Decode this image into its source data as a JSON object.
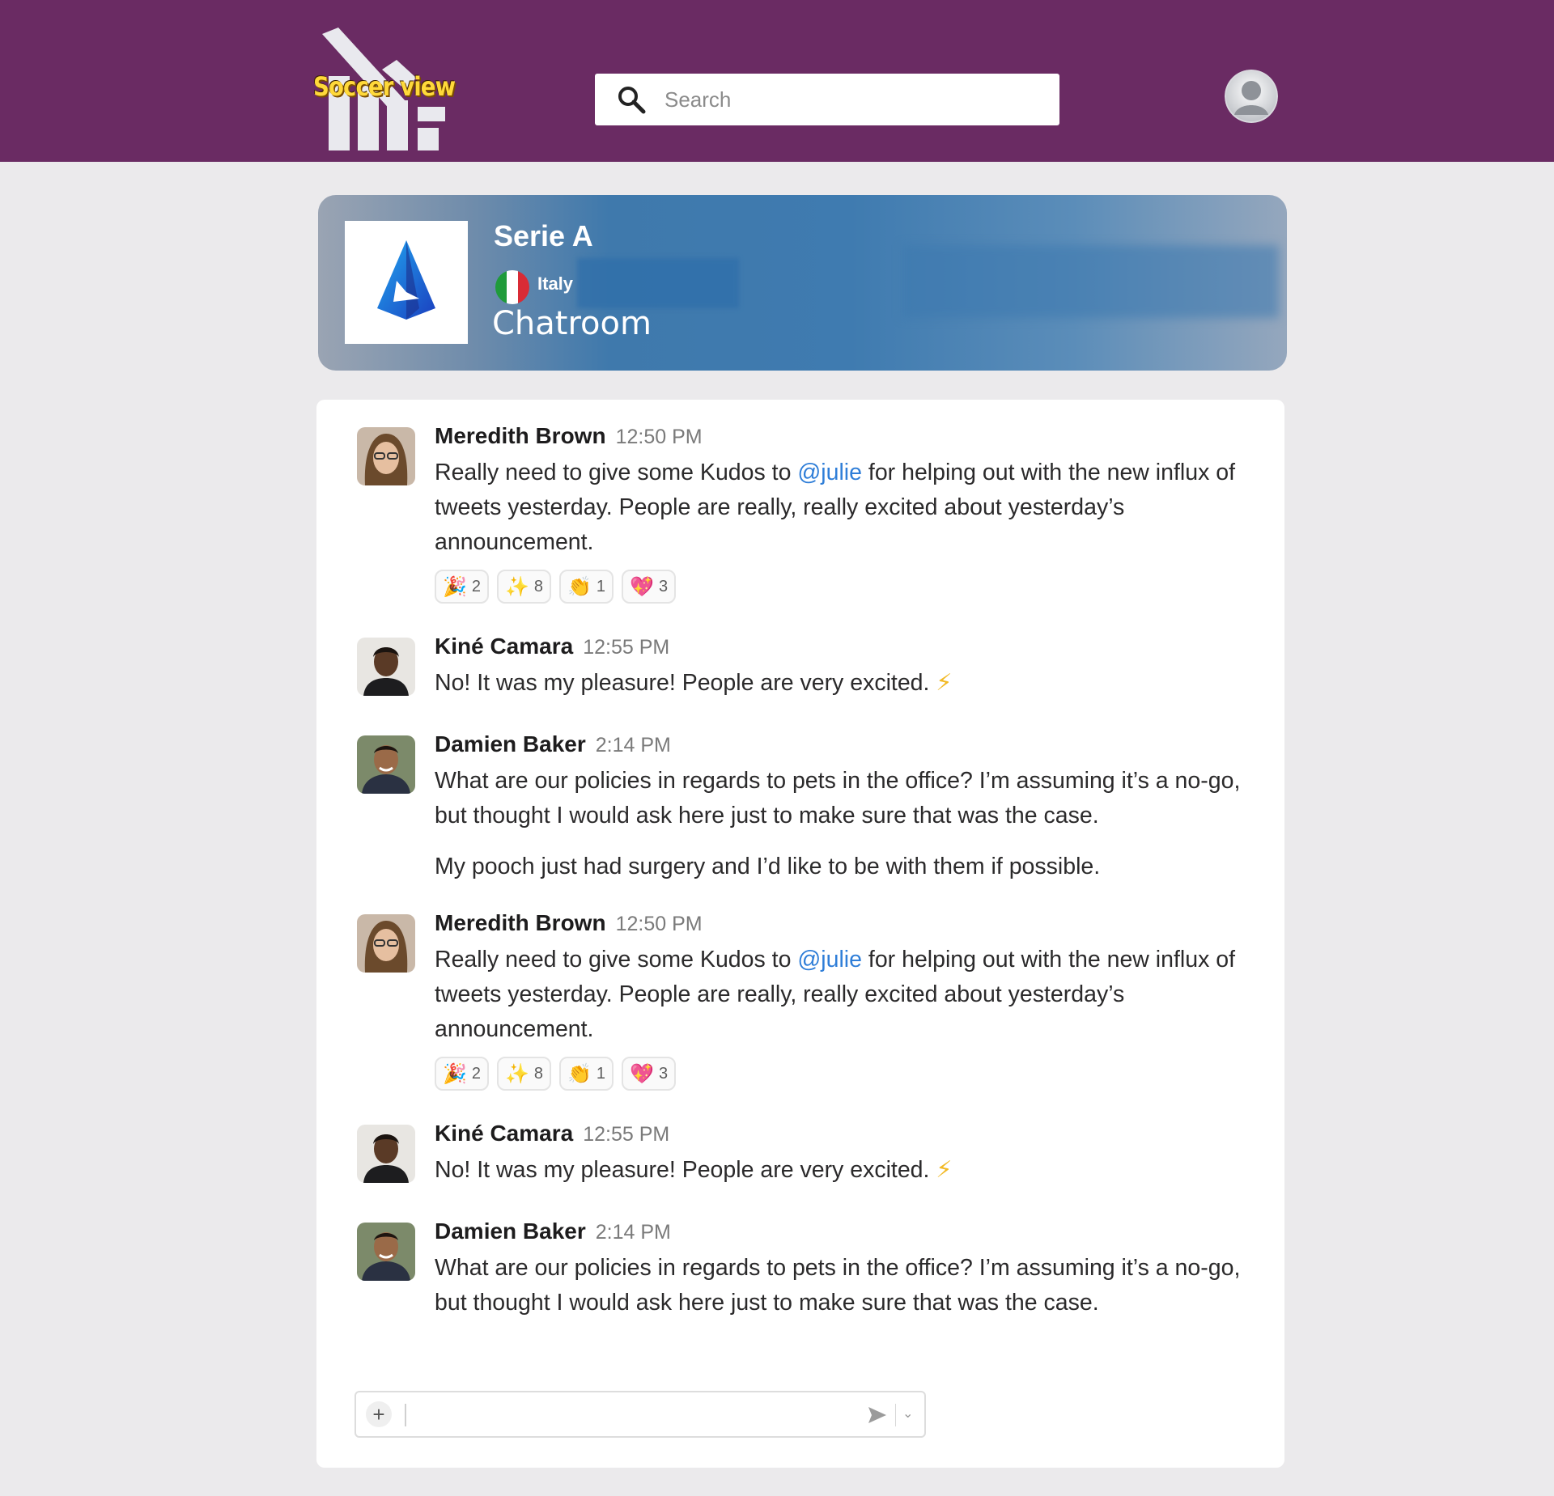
{
  "app": {
    "brand": "Soccer view",
    "search": {
      "placeholder": "Search"
    }
  },
  "league": {
    "name": "Serie A",
    "country": "Italy",
    "section": "Chatroom"
  },
  "colors": {
    "topbar": "#6a2b63",
    "brand_text": "#ffd93a",
    "mention": "#2f7ed8",
    "league_banner": "#3f79ac"
  },
  "messages": [
    {
      "author": "Meredith Brown",
      "time": "12:50 PM",
      "text_before": "Really need to give some Kudos to ",
      "mention": "@julie",
      "text_after": " for helping out with the new influx of tweets yesterday. People are really, really excited about yesterday’s announcement.",
      "reactions": [
        {
          "emoji": "🎉",
          "icon": "party-popper-icon",
          "count": "2"
        },
        {
          "emoji": "✨",
          "icon": "sparkles-icon",
          "count": "8"
        },
        {
          "emoji": "👏",
          "icon": "clapping-hands-icon",
          "count": "1"
        },
        {
          "emoji": "💖",
          "icon": "sparkling-heart-icon",
          "count": "3"
        }
      ]
    },
    {
      "author": "Kiné Camara",
      "time": "12:55 PM",
      "text": "No! It was my pleasure! People are very excited.",
      "emoji": "⚡"
    },
    {
      "author": "Damien Baker",
      "time": "2:14 PM",
      "text": "What are our policies in regards to pets in the office? I’m assuming it’s a no-go, but thought I would ask here just to make sure that was the case.",
      "text2": "My pooch just had surgery and I’d like to be with them if possible."
    },
    {
      "author": "Meredith Brown",
      "time": "12:50 PM",
      "text_before": "Really need to give some Kudos to ",
      "mention": "@julie",
      "text_after": " for helping out with the new influx of tweets yesterday. People are really, really excited about yesterday’s announcement.",
      "reactions": [
        {
          "emoji": "🎉",
          "icon": "party-popper-icon",
          "count": "2"
        },
        {
          "emoji": "✨",
          "icon": "sparkles-icon",
          "count": "8"
        },
        {
          "emoji": "👏",
          "icon": "clapping-hands-icon",
          "count": "1"
        },
        {
          "emoji": "💖",
          "icon": "sparkling-heart-icon",
          "count": "3"
        }
      ]
    },
    {
      "author": "Kiné Camara",
      "time": "12:55 PM",
      "text": "No! It was my pleasure! People are very excited.",
      "emoji": "⚡"
    },
    {
      "author": "Damien Baker",
      "time": "2:14 PM",
      "text": "What are our policies in regards to pets in the office? I’m assuming it’s a no-go, but thought I would ask here just to make sure that was the case."
    }
  ],
  "composer": {
    "add_icon": "plus-icon",
    "send_icon": "send-icon",
    "options_icon": "chevron-down-icon",
    "plus_glyph": "+",
    "chevron_glyph": "⌄"
  }
}
